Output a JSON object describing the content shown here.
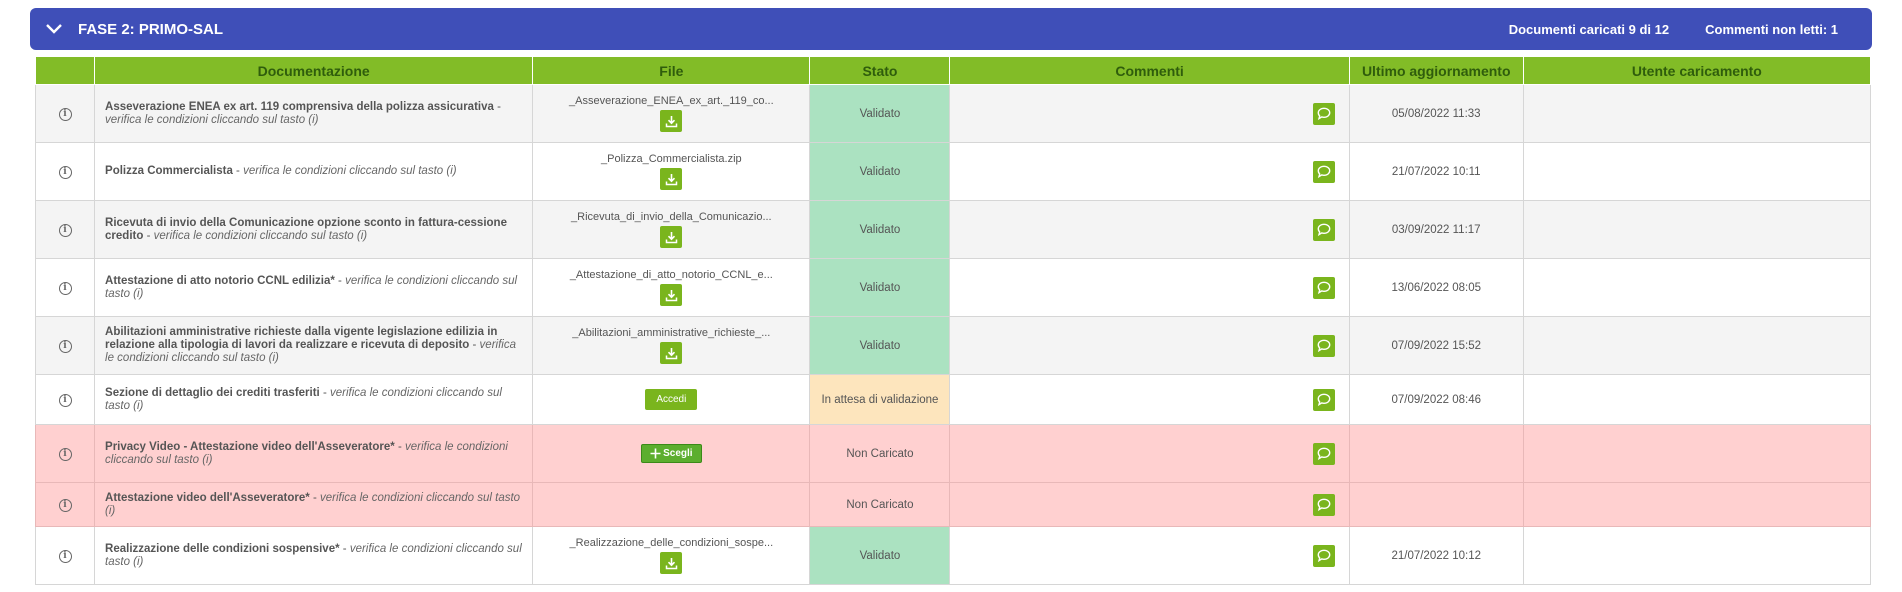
{
  "header": {
    "title": "FASE 2: PRIMO-SAL",
    "docs_loaded": "Documenti caricati 9 di 12",
    "unread_comments": "Commenti non letti: 1"
  },
  "columns": [
    "Documentazione",
    "File",
    "Stato",
    "Commenti",
    "Ultimo aggiornamento",
    "Utente caricamento"
  ],
  "verify_hint": "verifica le condizioni cliccando sul tasto (i)",
  "rows": [
    {
      "title": "Asseverazione ENEA ex art. 119 comprensiva della polizza assicurativa",
      "file": "_Asseverazione_ENEA_ex_art._119_co...",
      "action": "download",
      "status": "Validato",
      "updated": "05/08/2022 11:33"
    },
    {
      "title": "Polizza Commercialista",
      "file": "_Polizza_Commercialista.zip",
      "action": "download",
      "status": "Validato",
      "updated": "21/07/2022 10:11"
    },
    {
      "title": "Ricevuta di invio della Comunicazione opzione sconto in fattura-cessione credito",
      "file": "_Ricevuta_di_invio_della_Comunicazio...",
      "action": "download",
      "status": "Validato",
      "updated": "03/09/2022 11:17"
    },
    {
      "title": "Attestazione di atto notorio CCNL edilizia",
      "required": "*",
      "file": "_Attestazione_di_atto_notorio_CCNL_e...",
      "action": "download",
      "status": "Validato",
      "updated": "13/06/2022 08:05"
    },
    {
      "title": "Abilitazioni amministrative richieste dalla vigente legislazione edilizia in relazione alla tipologia di lavori da realizzare e ricevuta di deposito",
      "file": "_Abilitazioni_amministrative_richieste_...",
      "action": "download",
      "status": "Validato",
      "updated": "07/09/2022 15:52"
    },
    {
      "title": "Sezione di dettaglio dei crediti trasferiti",
      "file": "",
      "action": "accedi",
      "action_label": "Accedi",
      "status": "In attesa di validazione",
      "updated": "07/09/2022 08:46"
    },
    {
      "title": "Privacy Video - Attestazione video dell'Asseveratore",
      "required": "*",
      "file": "",
      "action": "scegli",
      "action_label": "Scegli",
      "status": "Non Caricato",
      "updated": ""
    },
    {
      "title": "Attestazione video dell'Asseveratore",
      "required": "*",
      "file": "",
      "action": "none",
      "status": "Non Caricato",
      "updated": ""
    },
    {
      "title": "Realizzazione delle condizioni sospensive",
      "required": "*",
      "file": "_Realizzazione_delle_condizioni_sospe...",
      "action": "download",
      "status": "Validato",
      "updated": "21/07/2022 10:12"
    }
  ],
  "colors": {
    "header_bg": "#3f4fb8",
    "table_header_bg": "#82bc27",
    "validated_bg": "#abe2c1",
    "pending_bg": "#fde5bd",
    "missing_row_bg": "#ffd0d0",
    "button_green": "#7ab51d"
  }
}
